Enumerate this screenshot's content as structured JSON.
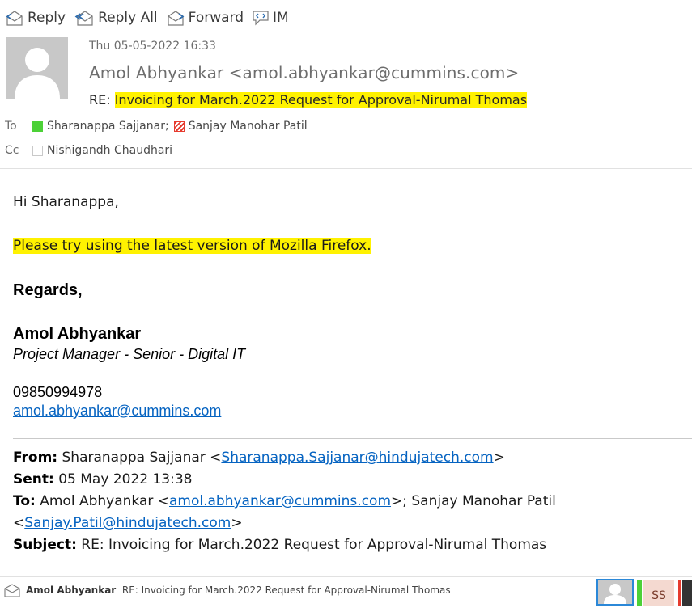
{
  "toolbar": {
    "reply_label": "Reply",
    "reply_all_label": "Reply All",
    "forward_label": "Forward",
    "im_label": "IM"
  },
  "header": {
    "date": "Thu 05-05-2022 16:33",
    "sender": "Amol Abhyankar <amol.abhyankar@cummins.com>",
    "subject_prefix": "RE: ",
    "subject_text": "Invoicing for March.2022 Request for Approval-Nirumal Thomas",
    "to_label": "To",
    "cc_label": "Cc",
    "to_recipients": [
      "Sharanappa Sajjanar;",
      "Sanjay Manohar Patil"
    ],
    "cc_recipients": [
      "Nishigandh Chaudhari"
    ]
  },
  "body": {
    "greeting": "Hi Sharanappa,",
    "message": "Please try using the latest version of Mozilla Firefox.",
    "regards": "Regards,",
    "signature_name": "Amol Abhyankar",
    "signature_title": "Project Manager - Senior - Digital IT",
    "signature_phone": "09850994978",
    "signature_email": "amol.abhyankar@cummins.com"
  },
  "quoted": {
    "from_label": "From:",
    "from_name": " Sharanappa Sajjanar <",
    "from_email": "Sharanappa.Sajjanar@hindujatech.com",
    "from_close": ">",
    "sent_label": "Sent:",
    "sent_value": " 05 May 2022 13:38",
    "to_label": "To:",
    "to_name1": " Amol Abhyankar <",
    "to_email1": "amol.abhyankar@cummins.com",
    "to_mid": ">; Sanjay Manohar Patil",
    "to_open2": "<",
    "to_email2": "Sanjay.Patil@hindujatech.com",
    "to_close2": ">",
    "subject_label": "Subject:",
    "subject_value": " RE: Invoicing for March.2022 Request for Approval-Nirumal Thomas"
  },
  "statusbar": {
    "sender": "Amol Abhyankar",
    "subject": "RE: Invoicing for March.2022 Request for Approval-Nirumal Thomas",
    "avatar_initials": "SS"
  },
  "colors": {
    "highlight": "#fff200",
    "link": "#0563c1",
    "presence_available": "#4cd137",
    "presence_busy": "#e63b2e"
  }
}
